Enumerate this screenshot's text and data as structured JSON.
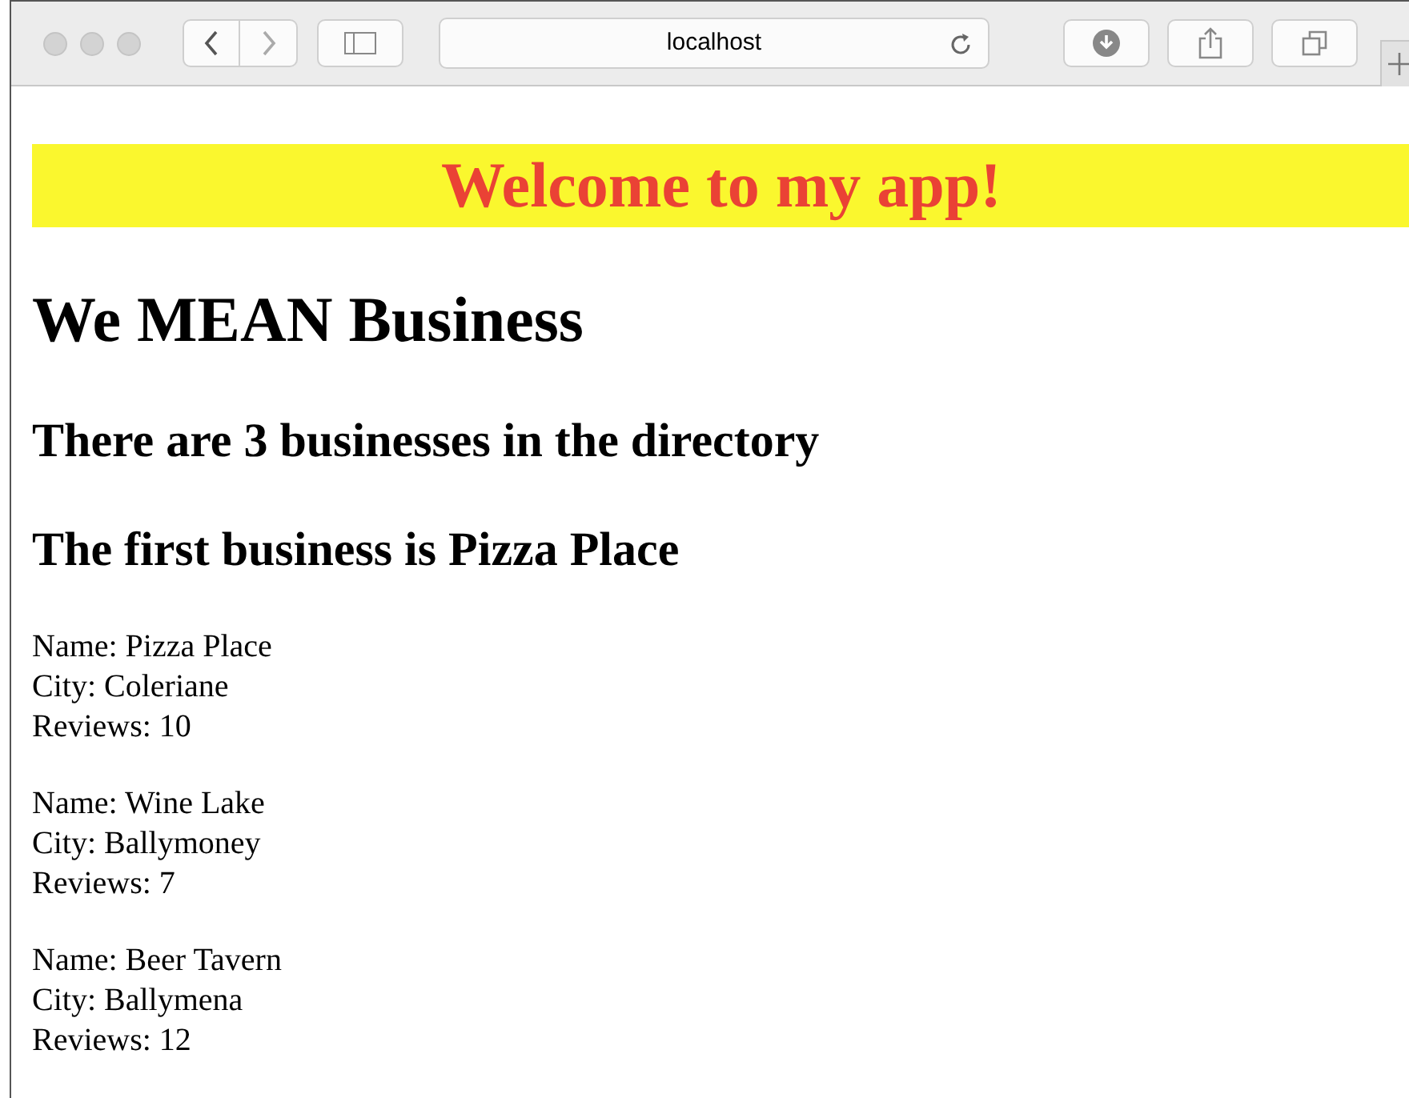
{
  "browser": {
    "address": "localhost"
  },
  "banner": {
    "title": "Welcome to my app!"
  },
  "page": {
    "heading": "We MEAN Business",
    "count_line": "There are 3 businesses in the directory",
    "first_line": "The first business is Pizza Place"
  },
  "businesses": [
    {
      "name": "Name: Pizza Place",
      "city": "City: Coleriane",
      "reviews": "Reviews: 10"
    },
    {
      "name": "Name: Wine Lake",
      "city": "City: Ballymoney",
      "reviews": "Reviews: 7"
    },
    {
      "name": "Name: Beer Tavern",
      "city": "City: Ballymena",
      "reviews": "Reviews: 12"
    }
  ]
}
